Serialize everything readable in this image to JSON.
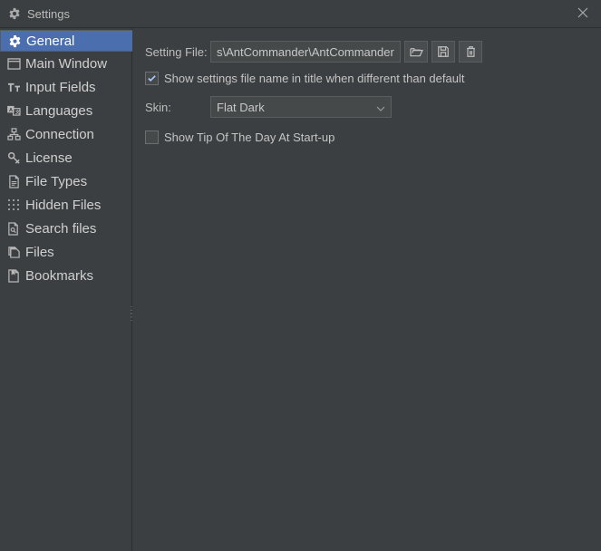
{
  "window": {
    "title": "Settings"
  },
  "sidebar": {
    "items": [
      {
        "label": "General",
        "icon": "gear"
      },
      {
        "label": "Main Window",
        "icon": "window"
      },
      {
        "label": "Input Fields",
        "icon": "text"
      },
      {
        "label": "Languages",
        "icon": "lang"
      },
      {
        "label": "Connection",
        "icon": "network"
      },
      {
        "label": "License",
        "icon": "key"
      },
      {
        "label": "File Types",
        "icon": "filetype"
      },
      {
        "label": "Hidden Files",
        "icon": "grid"
      },
      {
        "label": "Search files",
        "icon": "search"
      },
      {
        "label": "Files",
        "icon": "files"
      },
      {
        "label": "Bookmarks",
        "icon": "bookmark"
      }
    ],
    "selected": 0
  },
  "general": {
    "setting_file_label": "Setting File:",
    "setting_file_value": "s\\AntCommander\\AntCommander.ini",
    "show_filename_in_title": {
      "checked": true,
      "label": "Show settings file name in title when different than default"
    },
    "skin_label": "Skin:",
    "skin_value": "Flat Dark",
    "show_tip": {
      "checked": false,
      "label": "Show Tip Of The Day At Start-up"
    },
    "buttons": {
      "open": "Open",
      "save": "Save",
      "delete": "Delete"
    }
  }
}
